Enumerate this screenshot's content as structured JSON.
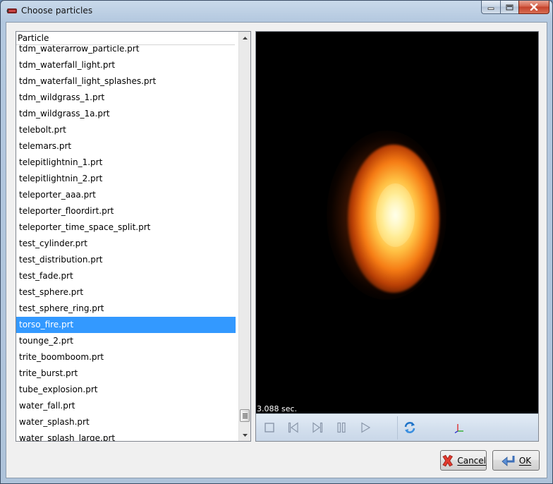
{
  "window": {
    "title": "Choose particles"
  },
  "list": {
    "header": "Particle",
    "items": [
      "tdm_waterarrow_particle.prt",
      "tdm_waterfall_light.prt",
      "tdm_waterfall_light_splashes.prt",
      "tdm_wildgrass_1.prt",
      "tdm_wildgrass_1a.prt",
      "telebolt.prt",
      "telemars.prt",
      "telepitlightnin_1.prt",
      "telepitlightnin_2.prt",
      "teleporter_aaa.prt",
      "teleporter_floordirt.prt",
      "teleporter_time_space_split.prt",
      "test_cylinder.prt",
      "test_distribution.prt",
      "test_fade.prt",
      "test_sphere.prt",
      "test_sphere_ring.prt",
      "torso_fire.prt",
      "tounge_2.prt",
      "trite_boomboom.prt",
      "trite_burst.prt",
      "tube_explosion.prt",
      "water_fall.prt",
      "water_splash.prt",
      "water_splash_large.prt"
    ],
    "selected_index": 17
  },
  "preview": {
    "time_readout": "3.088 sec."
  },
  "buttons": {
    "cancel": "Cancel",
    "ok": "OK"
  },
  "icons": {
    "app": "particle-app-icon",
    "stop": "stop-icon",
    "prev": "skip-back-icon",
    "next": "skip-forward-icon",
    "pause": "pause-icon",
    "play": "play-icon",
    "refresh": "refresh-icon",
    "axes": "axes-icon",
    "cancel": "cancel-x-icon",
    "ok": "ok-enter-icon"
  },
  "colors": {
    "selection": "#3399ff",
    "viewport_bg": "#000000",
    "close_button": "#c4412b"
  }
}
